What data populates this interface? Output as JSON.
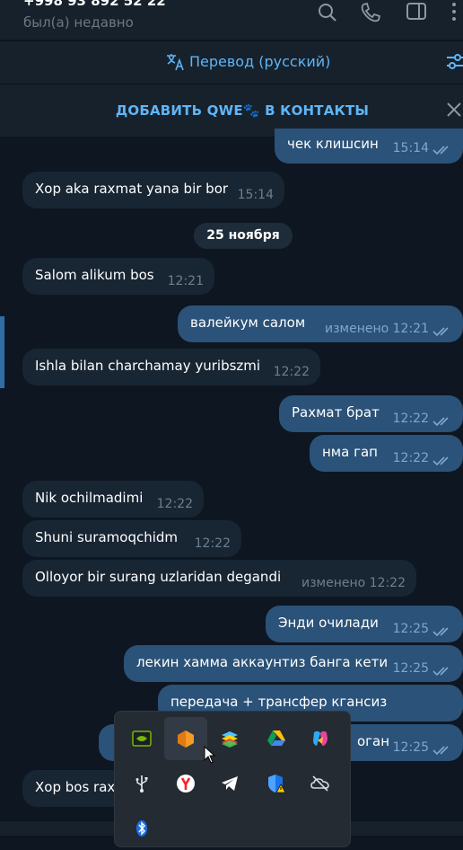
{
  "header": {
    "contact_phone": "+998 93 892 52 22",
    "status": "был(а) недавно",
    "icons": [
      "search-icon",
      "phone-icon",
      "sidebar-toggle-icon",
      "more-icon"
    ]
  },
  "translate_bar": {
    "label": "Перевод (русский)",
    "icon": "translate-icon",
    "settings_icon": "filter-icon"
  },
  "add_contact_bar": {
    "label": "ДОБАВИТЬ QWE🐾 В КОНТАКТЫ",
    "close_icon": "close-icon"
  },
  "messages": [
    {
      "dir": "out",
      "text": "чек клишсин",
      "time": "15:14"
    },
    {
      "dir": "in",
      "text": "Xop aka raxmat yana bir bor",
      "time": "15:14"
    },
    {
      "dir": "in",
      "text": "Salom alikum bos",
      "time": "12:21"
    },
    {
      "dir": "out",
      "text": "валейкум салом",
      "time": "изменено 12:21"
    },
    {
      "dir": "in",
      "text": "Ishla bilan charchamay yuribszmi",
      "time": "12:22"
    },
    {
      "dir": "out",
      "text": "Рахмат брат",
      "time": "12:22"
    },
    {
      "dir": "out",
      "text": "нма гап",
      "time": "12:22"
    },
    {
      "dir": "in",
      "text": "Nik ochilmadimi",
      "time": "12:22"
    },
    {
      "dir": "in",
      "text": "Shuni suramoqchidm",
      "time": "12:22"
    },
    {
      "dir": "in",
      "text": "Olloyor bir surang uzlaridan degandi",
      "time": "изменено 12:22"
    },
    {
      "dir": "out",
      "text": "Энди очилади",
      "time": "12:25"
    },
    {
      "dir": "out",
      "text": "лекин хамма аккаунтиз банга кети",
      "time": "12:25"
    },
    {
      "dir": "out",
      "text": "передача + трансфер кгансиз",
      "time": ""
    },
    {
      "dir": "out",
      "text": "оган",
      "time": "12:25"
    },
    {
      "dir": "in",
      "text": "Xop bos rax",
      "time": ""
    }
  ],
  "date_separator": "25 ноября",
  "tray_icons": [
    "nvidia-icon",
    "mullvad-fox-icon",
    "bluestacks-icon",
    "google-drive-icon",
    "copilot-icon",
    "usb-icon",
    "yandex-browser-icon",
    "telegram-icon",
    "windows-security-icon",
    "onedrive-offline-icon",
    "bluetooth-icon"
  ],
  "colors": {
    "bg": "#0e1621",
    "panel": "#17212b",
    "bubble_in": "#182533",
    "bubble_out": "#2b5278",
    "accent": "#5eb5f7"
  }
}
